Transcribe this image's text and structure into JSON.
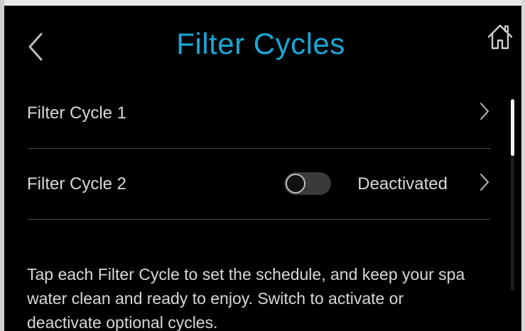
{
  "header": {
    "title": "Filter Cycles",
    "back_icon": "chevron-left-icon",
    "home_icon": "home-icon"
  },
  "filter_cycles": [
    {
      "label": "Filter Cycle 1",
      "has_toggle": false,
      "status": ""
    },
    {
      "label": "Filter Cycle 2",
      "has_toggle": true,
      "toggle_on": false,
      "status": "Deactivated"
    }
  ],
  "description": "Tap each Filter Cycle to set the schedule, and keep your spa\nwater clean and ready to enjoy. Switch to activate or\n deactivate optional cycles.",
  "colors": {
    "background": "#000000",
    "title_accent": "#1aa7d6",
    "text": "#d8d8d8",
    "divider": "#4a4a4a"
  }
}
